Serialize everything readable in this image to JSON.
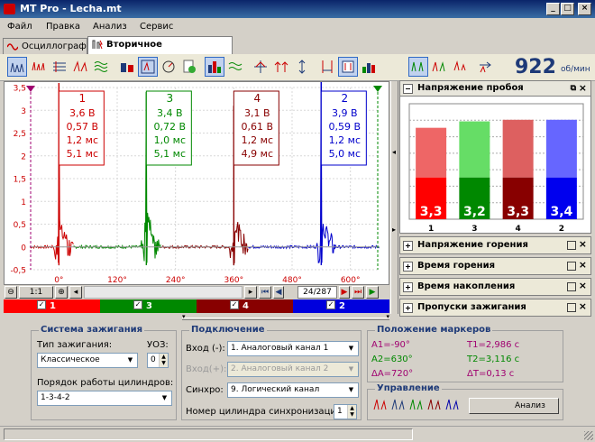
{
  "window": {
    "title": "MT Pro - Lecha.mt"
  },
  "menu": [
    "Файл",
    "Правка",
    "Анализ",
    "Сервис"
  ],
  "tabs": [
    {
      "label": "Осциллограф",
      "active": false
    },
    {
      "label": "Вторичное напряжение",
      "active": true
    }
  ],
  "toolbar": {
    "rpm_value": "922",
    "rpm_unit": "об/мин"
  },
  "chart_data": {
    "type": "line",
    "y_ticks": [
      "3,5",
      "3",
      "2,5",
      "2",
      "1,5",
      "1",
      "0,5",
      "0",
      "-0,5"
    ],
    "ylim": [
      -0.5,
      3.5
    ],
    "x_ticks": [
      "0°",
      "120°",
      "240°",
      "360°",
      "480°",
      "600°"
    ],
    "xlim": [
      -60,
      660
    ],
    "series": [
      {
        "name": "1",
        "color": "#cc0000",
        "x_range": [
          -60,
          30
        ],
        "spike_at": 0,
        "spike_peak": 3.6,
        "afterspike": 0.57
      },
      {
        "name": "3",
        "color": "#008800",
        "x_range": [
          30,
          210
        ],
        "spike_at": 180,
        "spike_peak": 3.4,
        "afterspike": 0.72
      },
      {
        "name": "4",
        "color": "#880000",
        "x_range": [
          210,
          390
        ],
        "spike_at": 360,
        "spike_peak": 3.1,
        "afterspike": 0.61
      },
      {
        "name": "2",
        "color": "#0000cc",
        "x_range": [
          390,
          660
        ],
        "spike_at": 540,
        "spike_peak": 3.9,
        "afterspike": 0.59
      }
    ],
    "labels": [
      {
        "cyl": "1",
        "lines": [
          "3,6 В",
          "0,57 В",
          "1,2 мс",
          "5,1 мс"
        ],
        "color": "#cc0000"
      },
      {
        "cyl": "3",
        "lines": [
          "3,4 В",
          "0,72 В",
          "1,0 мс",
          "5,1 мс"
        ],
        "color": "#008800"
      },
      {
        "cyl": "4",
        "lines": [
          "3,1 В",
          "0,61 В",
          "1,2 мс",
          "4,9 мс"
        ],
        "color": "#880000"
      },
      {
        "cyl": "2",
        "lines": [
          "3,9 В",
          "0,59 В",
          "1,2 мс",
          "5,0 мс"
        ],
        "color": "#0000cc"
      }
    ]
  },
  "navigation": {
    "zoom": "1:1",
    "frame": "24/287"
  },
  "cylinders": [
    {
      "label": "1",
      "color": "#ff0000"
    },
    {
      "label": "3",
      "color": "#008800"
    },
    {
      "label": "4",
      "color": "#880000"
    },
    {
      "label": "2",
      "color": "#0000dd"
    }
  ],
  "right_panel": {
    "active_section": "Напряжение пробоя",
    "bar_chart": {
      "type": "bar",
      "categories": [
        "1",
        "3",
        "4",
        "2"
      ],
      "values": [
        3.3,
        3.2,
        3.3,
        3.4
      ],
      "value_labels": [
        "3,3",
        "3,2",
        "3,3",
        "3,4"
      ],
      "top_values": [
        2.85,
        3.05,
        3.1,
        3.1
      ],
      "colors_dark": [
        "#ff0000",
        "#008800",
        "#880000",
        "#0000ee"
      ],
      "colors_light": [
        "#ee6666",
        "#66dd66",
        "#dd6060",
        "#6666ff"
      ]
    },
    "sections": [
      "Напряжение горения",
      "Время горения",
      "Время накопления",
      "Пропуски зажигания"
    ]
  },
  "ignition": {
    "title": "Система зажигания",
    "type_label": "Тип зажигания:",
    "type_value": "Классическое",
    "uoz_label": "УОЗ:",
    "uoz_value": "0",
    "order_label": "Порядок работы цилиндров:",
    "order_value": "1-3-4-2"
  },
  "connection": {
    "title": "Подключение",
    "input_minus_label": "Вход (-):",
    "input_minus_value": "1. Аналоговый канал 1",
    "input_plus_label": "Вход(+):",
    "input_plus_value": "2. Аналоговый канал 2",
    "sync_label": "Синхро:",
    "sync_value": "9. Логический канал",
    "sync_cyl_label": "Номер цилиндра синхронизации:",
    "sync_cyl_value": "1"
  },
  "markers": {
    "title": "Положение маркеров",
    "a1": "A1=-90°",
    "a2": "A2=630°",
    "da": "ΔA=720°",
    "t1": "T1=2,986 с",
    "t2": "T2=3,116 с",
    "dt": "ΔT=0,13 с"
  },
  "control": {
    "title": "Управление",
    "analysis_label": "Анализ"
  }
}
